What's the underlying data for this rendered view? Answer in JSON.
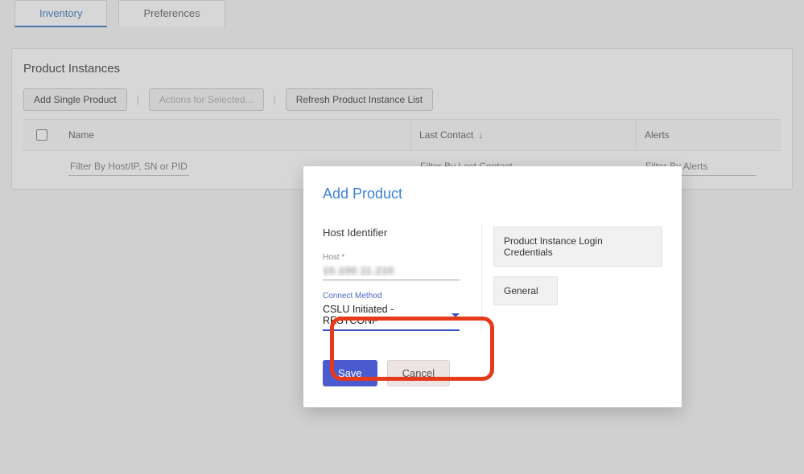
{
  "tabs": {
    "inventory": "Inventory",
    "preferences": "Preferences"
  },
  "panel": {
    "title": "Product Instances",
    "toolbar": {
      "add_single": "Add Single Product",
      "actions_selected": "Actions for Selected...",
      "refresh": "Refresh Product Instance List"
    },
    "columns": {
      "name": "Name",
      "last_contact": "Last Contact",
      "alerts": "Alerts"
    },
    "filters": {
      "name_ph": "Filter By Host/IP, SN or PID",
      "last_ph": "Filter By Last Contact",
      "alerts_ph": "Filter By Alerts"
    }
  },
  "modal": {
    "title": "Add Product",
    "host_identifier_label": "Host Identifier",
    "host_field_label": "Host *",
    "host_value": "10.100.11.210",
    "connect_method_label": "Connect Method",
    "connect_method_value": "CSLU Initiated - RESTCONF",
    "side": {
      "credentials": "Product Instance Login Credentials",
      "general": "General"
    },
    "actions": {
      "save": "Save",
      "cancel": "Cancel"
    }
  }
}
